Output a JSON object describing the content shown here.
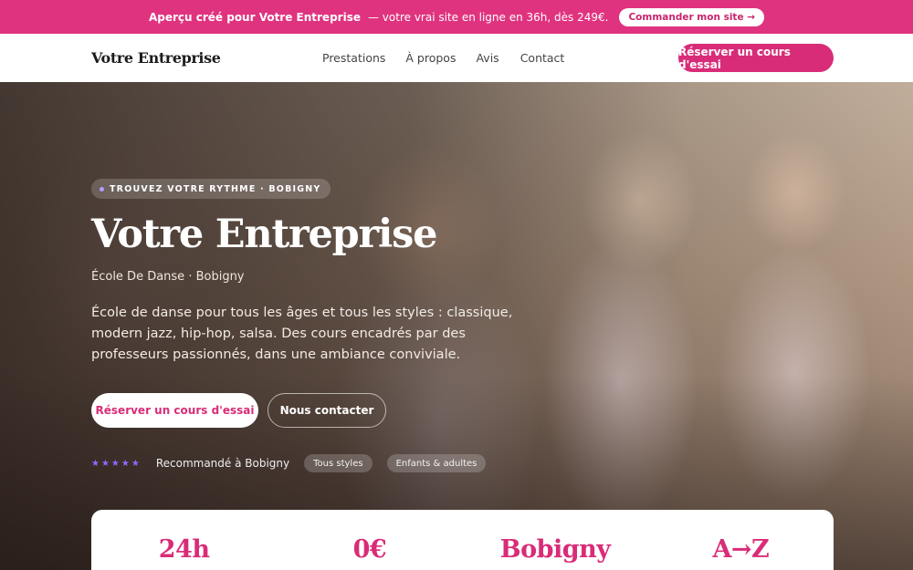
{
  "promo": {
    "highlight": "Aperçu créé pour Votre Entreprise",
    "text": "— votre vrai site en ligne en 36h, dès 249€.",
    "button": "Commander mon site →"
  },
  "nav": {
    "brand": "Votre Entreprise",
    "links": [
      "Prestations",
      "À propos",
      "Avis",
      "Contact"
    ],
    "cta": "Réserver un cours d'essai"
  },
  "hero": {
    "eyebrow": "TROUVEZ VOTRE RYTHME · BOBIGNY",
    "title": "Votre Entreprise",
    "subtitle": "École De Danse · Bobigny",
    "description": "École de danse pour tous les âges et tous les styles : classique, modern jazz, hip-hop, salsa. Des cours encadrés par des professeurs passionnés, dans une ambiance conviviale.",
    "primary_button": "Réserver un cours d'essai",
    "secondary_button": "Nous contacter",
    "stars": "★★★★★",
    "trust_text": "Recommandé à Bobigny",
    "chips": [
      "Tous styles",
      "Enfants & adultes"
    ]
  },
  "stats": [
    "24h",
    "0€",
    "Bobigny",
    "A→Z"
  ],
  "colors": {
    "accent": "#d92c78",
    "promo_bg": "#e0337f",
    "star": "#8b6cff"
  }
}
